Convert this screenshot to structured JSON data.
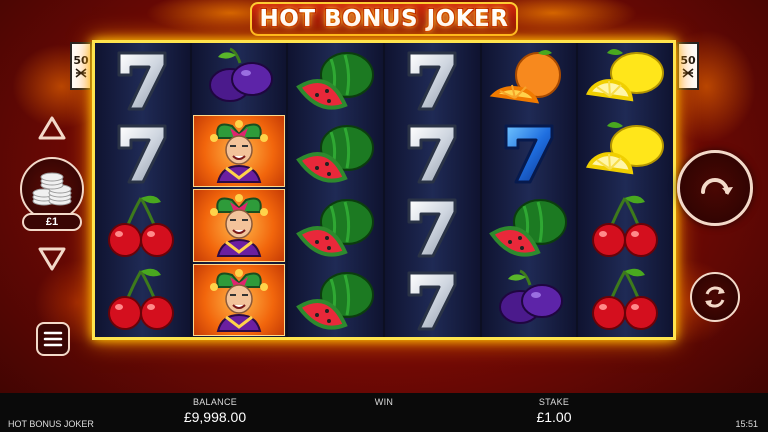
{
  "game": {
    "title": "HOT BONUS JOKER",
    "lines_badge_left": {
      "number": "50",
      "icon": "payline-icon"
    },
    "lines_badge_right": {
      "number": "50",
      "icon": "payline-icon"
    }
  },
  "reels": [
    [
      "seven",
      "seven",
      "cherry",
      "cherry"
    ],
    [
      "plum",
      "joker",
      "joker",
      "joker"
    ],
    [
      "watermelon",
      "watermelon",
      "watermelon",
      "watermelon"
    ],
    [
      "seven",
      "seven",
      "seven",
      "seven"
    ],
    [
      "orange",
      "seven-blue",
      "watermelon",
      "plum"
    ],
    [
      "lemon",
      "lemon",
      "cherry",
      "cherry"
    ]
  ],
  "controls": {
    "bet_up_icon": "triangle-up-icon",
    "bet_down_icon": "triangle-down-icon",
    "coin_icon": "coin-stack-icon",
    "coin_value": "£1",
    "menu_icon": "hamburger-menu-icon",
    "spin_icon": "spin-arrow-icon",
    "autoplay_icon": "autoplay-icon"
  },
  "footer": {
    "game_name": "HOT BONUS JOKER",
    "balance_label": "BALANCE",
    "balance_value": "£9,998.00",
    "win_label": "WIN",
    "win_value": "",
    "stake_label": "STAKE",
    "stake_value": "£1.00",
    "clock": "15:51"
  },
  "colors": {
    "frame_glow": "#ffe44d",
    "background": "#8a0d06",
    "footer": "#0a0a0a"
  }
}
